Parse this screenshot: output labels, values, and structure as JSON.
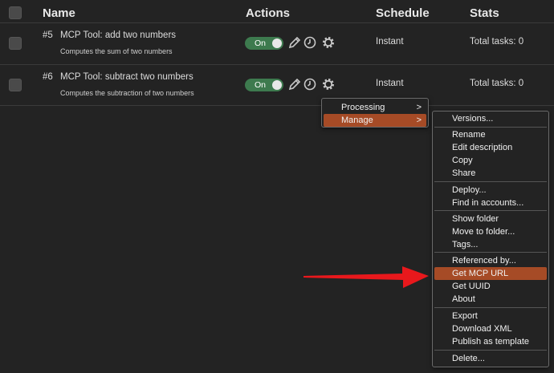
{
  "header": {
    "name": "Name",
    "actions": "Actions",
    "schedule": "Schedule",
    "stats": "Stats"
  },
  "rows": [
    {
      "number": "#5",
      "title": "MCP Tool: add two numbers",
      "description": "Computes the sum of two numbers",
      "toggle": "On",
      "schedule": "Instant",
      "stats": "Total tasks: 0"
    },
    {
      "number": "#6",
      "title": "MCP Tool: subtract two numbers",
      "description": "Computes the subtraction of two numbers",
      "toggle": "On",
      "schedule": "Instant",
      "stats": "Total tasks: 0"
    }
  ],
  "context_menu": {
    "items": [
      "Processing",
      "Manage"
    ],
    "highlighted": "Manage"
  },
  "submenu": {
    "items": [
      "Versions...",
      "Rename",
      "Edit description",
      "Copy",
      "Share",
      "Deploy...",
      "Find in accounts...",
      "Show folder",
      "Move to folder...",
      "Tags...",
      "Referenced by...",
      "Get MCP URL",
      "Get UUID",
      "About",
      "Export",
      "Download XML",
      "Publish as template",
      "Delete..."
    ],
    "highlighted": "Get MCP URL"
  },
  "icons": {
    "edit": "pencil-icon",
    "history": "clock-history-icon",
    "settings": "gear-icon",
    "toggle_knob": "globe-icon"
  },
  "colors": {
    "background": "#232323",
    "toggle_on": "#3d7a4e",
    "highlight": "#a64b26",
    "arrow": "#e8181c"
  }
}
